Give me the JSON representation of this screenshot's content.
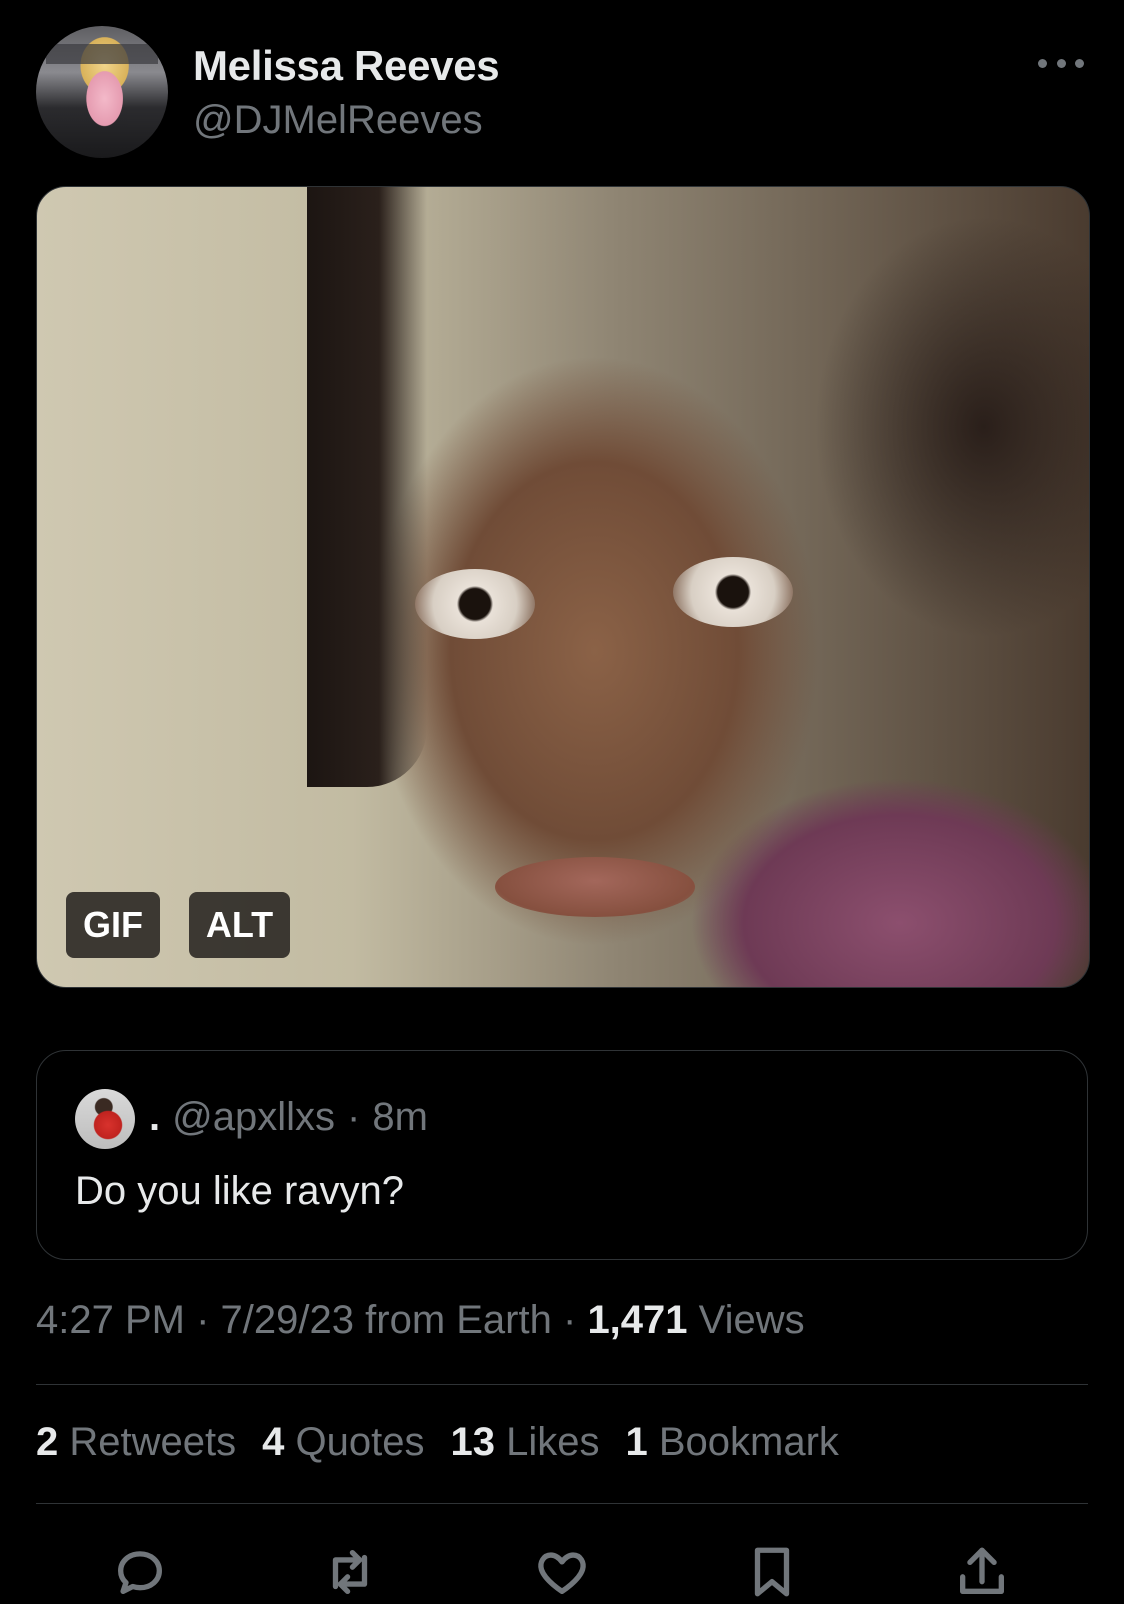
{
  "tweet": {
    "author_name": "Melissa Reeves",
    "author_handle": "@DJMelReeves",
    "media": {
      "gif_label": "GIF",
      "alt_label": "ALT"
    },
    "quote": {
      "name": ".",
      "handle": "@apxllxs",
      "separator": "·",
      "time": "8m",
      "text": "Do you like ravyn?"
    },
    "meta": {
      "time": "4:27 PM",
      "sep1": "·",
      "date": "7/29/23",
      "source": "from Earth",
      "sep2": "·",
      "views_count": "1,471",
      "views_label": "Views"
    },
    "stats": {
      "retweets_count": "2",
      "retweets_label": "Retweets",
      "quotes_count": "4",
      "quotes_label": "Quotes",
      "likes_count": "13",
      "likes_label": "Likes",
      "bookmarks_count": "1",
      "bookmarks_label": "Bookmark"
    },
    "actions": [
      "reply-icon",
      "retweet-icon",
      "like-icon",
      "bookmark-icon",
      "share-icon"
    ]
  },
  "colors": {
    "background": "#000000",
    "text": "#e7e9ea",
    "muted": "#71767b",
    "border": "#2f3336"
  }
}
